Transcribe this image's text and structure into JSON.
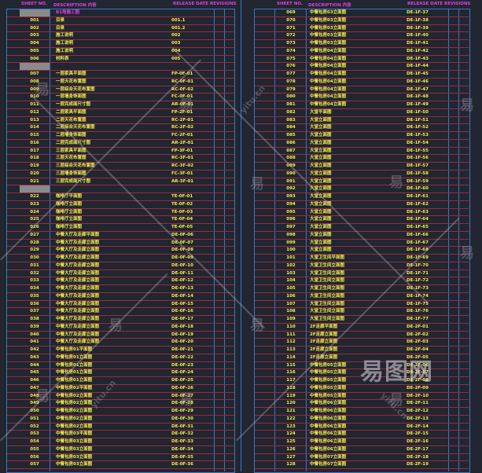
{
  "headers": {
    "sheet_no": "SHEET NO.",
    "description": "DESCRIPTION  内容",
    "release": "RELEASE DATE REVISIONS"
  },
  "watermark": {
    "brand": "易图网",
    "glyph": "易",
    "site": "yitu.cn"
  },
  "left_rows": [
    {
      "section": true,
      "no": "",
      "desc": "B1地施工图",
      "code": ""
    },
    {
      "no": "001",
      "desc": "目录",
      "code": "001.1"
    },
    {
      "no": "002",
      "desc": "目录",
      "code": "001.2"
    },
    {
      "no": "003",
      "desc": "施工说明",
      "code": "002"
    },
    {
      "no": "004",
      "desc": "施工说明",
      "code": "003"
    },
    {
      "no": "005",
      "desc": "施工说明",
      "code": "004"
    },
    {
      "no": "006",
      "desc": "材料表",
      "code": "005"
    },
    {
      "section": true,
      "no": "",
      "desc": "",
      "code": ""
    },
    {
      "no": "007",
      "desc": "一层家具平面图",
      "code": "FP-0F-01"
    },
    {
      "no": "008",
      "desc": "一层天花布置图",
      "code": "RC-0F-01"
    },
    {
      "no": "009",
      "desc": "一层综合天花布置图",
      "code": "RC-0F-02"
    },
    {
      "no": "010",
      "desc": "一层墙身饰面图",
      "code": "FC-0F-01"
    },
    {
      "no": "011",
      "desc": "一层完成面尺寸图",
      "code": "AR-0F-01"
    },
    {
      "no": "012",
      "desc": "二层家具平面图",
      "code": "FP-2F-01"
    },
    {
      "no": "013",
      "desc": "二层天花布置图",
      "code": "RC-2F-01"
    },
    {
      "no": "014",
      "desc": "二层综合天花布置图",
      "code": "RC-2F-02"
    },
    {
      "no": "015",
      "desc": "二层墙身饰面图",
      "code": "FC-2F-01"
    },
    {
      "no": "016",
      "desc": "二层完成面尺寸图",
      "code": "AR-2F-01"
    },
    {
      "no": "017",
      "desc": "三层家具平面图",
      "code": "FP-3F-01"
    },
    {
      "no": "018",
      "desc": "三层天花布置图",
      "code": "RC-3F-01"
    },
    {
      "no": "019",
      "desc": "三层综合天花布置图",
      "code": "RC-3F-02"
    },
    {
      "no": "020",
      "desc": "三层墙身饰面图",
      "code": "FC-3F-01"
    },
    {
      "no": "021",
      "desc": "三层完成面尺寸图",
      "code": "AR-3F-01"
    },
    {
      "section": true,
      "no": "",
      "desc": "",
      "code": ""
    },
    {
      "no": "022",
      "desc": "咖啡厅平面图",
      "code": "TE-0F-01"
    },
    {
      "no": "023",
      "desc": "咖啡厅立面图",
      "code": "TE-0F-02"
    },
    {
      "no": "024",
      "desc": "咖啡厅立面图",
      "code": "TE-0F-03"
    },
    {
      "no": "025",
      "desc": "咖啡厅立面图",
      "code": "TE-0F-04"
    },
    {
      "no": "026",
      "desc": "咖啡厅立面图",
      "code": "TE-0F-05"
    },
    {
      "no": "027",
      "desc": "中餐大厅及走廊平面图",
      "code": "DE-0F-06"
    },
    {
      "no": "028",
      "desc": "中餐大厅及走廊立面图",
      "code": "DE-0F-07"
    },
    {
      "no": "029",
      "desc": "中餐大厅及走廊立面图",
      "code": "DE-0F-08"
    },
    {
      "no": "030",
      "desc": "中餐大厅及走廊立面图",
      "code": "DE-0F-09"
    },
    {
      "no": "031",
      "desc": "中餐大厅及走廊立面图",
      "code": "DE-0F-10"
    },
    {
      "no": "032",
      "desc": "中餐大厅及走廊立面图",
      "code": "DE-0F-11"
    },
    {
      "no": "033",
      "desc": "中餐大厅及走廊立面图",
      "code": "DE-0F-12"
    },
    {
      "no": "034",
      "desc": "中餐大厅及走廊立面图",
      "code": "DE-0F-13"
    },
    {
      "no": "035",
      "desc": "中餐大厅及走廊立面图",
      "code": "DE-0F-14"
    },
    {
      "no": "036",
      "desc": "中餐大厅及走廊立面图",
      "code": "DE-0F-15"
    },
    {
      "no": "037",
      "desc": "中餐大厅及走廊立面图",
      "code": "DE-0F-16"
    },
    {
      "no": "038",
      "desc": "中餐大厅及走廊立面图",
      "code": "DE-0F-17"
    },
    {
      "no": "039",
      "desc": "中餐大厅及走廊立面图",
      "code": "DE-0F-18"
    },
    {
      "no": "040",
      "desc": "中餐大厅及走廊立面图",
      "code": "DE-0F-19"
    },
    {
      "no": "041",
      "desc": "中餐大厅及走廊立面图",
      "code": "DE-0F-20"
    },
    {
      "no": "042",
      "desc": "中餐包房01平面图",
      "code": "DE-0F-21"
    },
    {
      "no": "043",
      "desc": "中餐包房01立面图",
      "code": "DE-0F-22"
    },
    {
      "no": "044",
      "desc": "中餐包房01立面图",
      "code": "DE-0F-23"
    },
    {
      "no": "045",
      "desc": "中餐包房01立面图",
      "code": "DE-0F-24"
    },
    {
      "no": "046",
      "desc": "中餐包房01立面图",
      "code": "DE-0F-25"
    },
    {
      "no": "047",
      "desc": "中餐包房02平面图",
      "code": "DE-0F-26"
    },
    {
      "no": "048",
      "desc": "中餐包房02立面图",
      "code": "DE-0F-27"
    },
    {
      "no": "049",
      "desc": "中餐包房02立面图",
      "code": "DE-0F-28"
    },
    {
      "no": "050",
      "desc": "中餐包房02立面图",
      "code": "DE-0F-29"
    },
    {
      "no": "051",
      "desc": "中餐包房02立面图",
      "code": "DE-0F-30"
    },
    {
      "no": "052",
      "desc": "中餐包房02立面图",
      "code": "DE-0F-31"
    },
    {
      "no": "053",
      "desc": "中餐包房03平面图",
      "code": "DE-0F-32"
    },
    {
      "no": "054",
      "desc": "中餐包房03立面图",
      "code": "DE-0F-33"
    },
    {
      "no": "055",
      "desc": "中餐包房03立面图",
      "code": "DE-0F-34"
    },
    {
      "no": "056",
      "desc": "中餐包房03立面图",
      "code": "DE-0F-35"
    },
    {
      "no": "057",
      "desc": "中餐包房03立面图",
      "code": "DE-0F-36"
    }
  ],
  "right_rows": [
    {
      "no": "069",
      "desc": "中餐包房03立面图",
      "code": "DE-1F-37"
    },
    {
      "no": "070",
      "desc": "中餐包房03立面图",
      "code": "DE-1F-38"
    },
    {
      "no": "071",
      "desc": "中餐包房03立面图",
      "code": "DE-1F-39"
    },
    {
      "no": "072",
      "desc": "中餐包房03立面图",
      "code": "DE-1F-40"
    },
    {
      "no": "073",
      "desc": "中餐包房03立面图",
      "code": "DE-1F-41"
    },
    {
      "no": "074",
      "desc": "中餐包房04立面图",
      "code": "DE-1F-42"
    },
    {
      "no": "075",
      "desc": "中餐包房04立面图",
      "code": "DE-1F-43"
    },
    {
      "no": "076",
      "desc": "中餐包房04立面图",
      "code": "DE-1F-44"
    },
    {
      "no": "077",
      "desc": "中餐包房04立面图",
      "code": "DE-1F-45"
    },
    {
      "no": "078",
      "desc": "中餐包房04立面图",
      "code": "DE-1F-46"
    },
    {
      "no": "079",
      "desc": "中餐包房04立面图",
      "code": "DE-1F-47"
    },
    {
      "no": "080",
      "desc": "中餐包房04立面图",
      "code": "DE-1F-48"
    },
    {
      "no": "081",
      "desc": "中餐包房04立面图",
      "code": "DE-1F-49"
    },
    {
      "no": "082",
      "desc": "大堂平面图",
      "code": "DE-1F-50"
    },
    {
      "no": "083",
      "desc": "大堂立面图",
      "code": "DE-1F-51"
    },
    {
      "no": "084",
      "desc": "大堂立面图",
      "code": "DE-1F-52"
    },
    {
      "no": "085",
      "desc": "大堂立面图",
      "code": "DE-1F-53"
    },
    {
      "no": "086",
      "desc": "大堂立面图",
      "code": "DE-1F-54"
    },
    {
      "no": "087",
      "desc": "大堂立面图",
      "code": "DE-1F-55"
    },
    {
      "no": "088",
      "desc": "大堂立面图",
      "code": "DE-1F-56"
    },
    {
      "no": "089",
      "desc": "大堂立面图",
      "code": "DE-1F-57"
    },
    {
      "no": "090",
      "desc": "大堂立面图",
      "code": "DE-1F-58"
    },
    {
      "no": "091",
      "desc": "大堂立面图",
      "code": "DE-1F-59"
    },
    {
      "no": "092",
      "desc": "大堂立面图",
      "code": "DE-1F-60"
    },
    {
      "no": "093",
      "desc": "大堂立面图",
      "code": "DE-1F-61"
    },
    {
      "no": "094",
      "desc": "大堂立面图",
      "code": "DE-1F-62"
    },
    {
      "no": "095",
      "desc": "大堂立面图",
      "code": "DE-1F-63"
    },
    {
      "no": "096",
      "desc": "大堂立面图",
      "code": "DE-1F-64"
    },
    {
      "no": "097",
      "desc": "大堂立面图",
      "code": "DE-1F-65"
    },
    {
      "no": "098",
      "desc": "大堂立面图",
      "code": "DE-1F-66"
    },
    {
      "no": "099",
      "desc": "大堂立面图",
      "code": "DE-1F-67"
    },
    {
      "no": "100",
      "desc": "大堂立面图",
      "code": "DE-1F-68"
    },
    {
      "no": "101",
      "desc": "大堂卫生间平面图",
      "code": "DE-1F-69"
    },
    {
      "no": "102",
      "desc": "大堂卫生间立面图",
      "code": "DE-1F-70"
    },
    {
      "no": "103",
      "desc": "大堂卫生间立面图",
      "code": "DE-1F-71"
    },
    {
      "no": "104",
      "desc": "大堂卫生间立面图",
      "code": "DE-1F-72"
    },
    {
      "no": "105",
      "desc": "大堂卫生间立面图",
      "code": "DE-1F-73"
    },
    {
      "no": "106",
      "desc": "大堂卫生间立面图",
      "code": "DE-1F-74"
    },
    {
      "no": "107",
      "desc": "大堂卫生间立面图",
      "code": "DE-1F-75"
    },
    {
      "no": "108",
      "desc": "大堂卫生间立面图",
      "code": "DE-1F-76"
    },
    {
      "no": "109",
      "desc": "大堂卫生间立面图",
      "code": "DE-1F-77"
    },
    {
      "no": "110",
      "desc": "2F走廊平面图",
      "code": "DE-2F-01"
    },
    {
      "no": "111",
      "desc": "2F走廊立面图",
      "code": "DE-2F-02"
    },
    {
      "no": "112",
      "desc": "2F走廊立面图",
      "code": "DE-2F-03"
    },
    {
      "no": "113",
      "desc": "2F走廊立面图",
      "code": "DE-2F-04"
    },
    {
      "no": "114",
      "desc": "2F走廊立面图",
      "code": "DE-2F-05"
    },
    {
      "no": "115",
      "desc": "中餐包房05立面图",
      "code": "DE-2F-06"
    },
    {
      "no": "116",
      "desc": "中餐包房05立面图",
      "code": "DE-2F-07"
    },
    {
      "no": "117",
      "desc": "中餐包房05立面图",
      "code": "DE-2F-08"
    },
    {
      "no": "118",
      "desc": "中餐包房05立面图",
      "code": "DE-2F-09"
    },
    {
      "no": "119",
      "desc": "中餐包房05立面图",
      "code": "DE-2F-10"
    },
    {
      "no": "120",
      "desc": "中餐包房06立面图",
      "code": "DE-2F-11"
    },
    {
      "no": "121",
      "desc": "中餐包房06立面图",
      "code": "DE-2F-12"
    },
    {
      "no": "122",
      "desc": "中餐包房06立面图",
      "code": "DE-2F-13"
    },
    {
      "no": "123",
      "desc": "中餐包房06立面图",
      "code": "DE-2F-14"
    },
    {
      "no": "124",
      "desc": "中餐包房06立面图",
      "code": "DE-2F-15"
    },
    {
      "no": "125",
      "desc": "中餐包房06立面图",
      "code": "DE-2F-16"
    },
    {
      "no": "126",
      "desc": "中餐包房06立面图",
      "code": "DE-2F-17"
    },
    {
      "no": "127",
      "desc": "中餐包房07立面图",
      "code": "DE-2F-18"
    },
    {
      "no": "128",
      "desc": "中餐包房07立面图",
      "code": "DE-2F-19"
    }
  ]
}
